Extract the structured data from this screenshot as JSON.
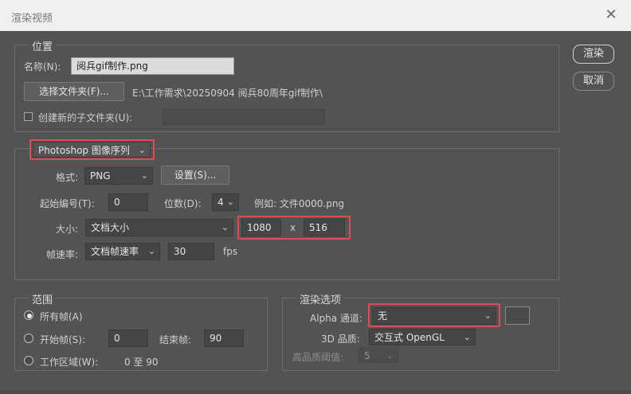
{
  "window": {
    "title": "渲染视频"
  },
  "actions": {
    "render": "渲染",
    "cancel": "取消"
  },
  "location": {
    "legend": "位置",
    "name_label": "名称(N):",
    "name_value": "阅兵gif制作.png",
    "choose_folder": "选择文件夹(F)...",
    "folder_path": "E:\\工作需求\\20250904 阅兵80周年gif制作\\",
    "subfolder_label": "创建新的子文件夹(U):",
    "subfolder_value": ""
  },
  "export": {
    "type": "Photoshop 图像序列",
    "format_label": "格式:",
    "format_value": "PNG",
    "settings_button": "设置(S)...",
    "start_number_label": "起始编号(T):",
    "start_number_value": "0",
    "digits_label": "位数(D):",
    "digits_value": "4",
    "example": "例如: 文件0000.png",
    "size_label": "大小:",
    "size_value": "文档大小",
    "width_value": "1080",
    "x_symbol": "x",
    "height_value": "516",
    "framerate_label": "帧速率:",
    "framerate_preset": "文档帧速率",
    "framerate_value": "30",
    "fps_label": "fps"
  },
  "range": {
    "legend": "范围",
    "all_frames": "所有帧(A)",
    "start_frame_label": "开始帧(S):",
    "start_frame_value": "0",
    "end_frame_label": "结束帧:",
    "end_frame_value": "90",
    "work_area_label": "工作区域(W):",
    "work_area_value": "0 至 90"
  },
  "render_options": {
    "legend": "渲染选项",
    "alpha_label": "Alpha 通道:",
    "alpha_value": "无",
    "quality_3d_label": "3D 品质:",
    "quality_3d_value": "交互式 OpenGL",
    "hq_threshold_label": "高品质阈值:",
    "hq_threshold_value": "5"
  },
  "colors": {
    "highlight": "#e24a52",
    "panel": "#535353",
    "titlebar": "#f0f0f0"
  }
}
